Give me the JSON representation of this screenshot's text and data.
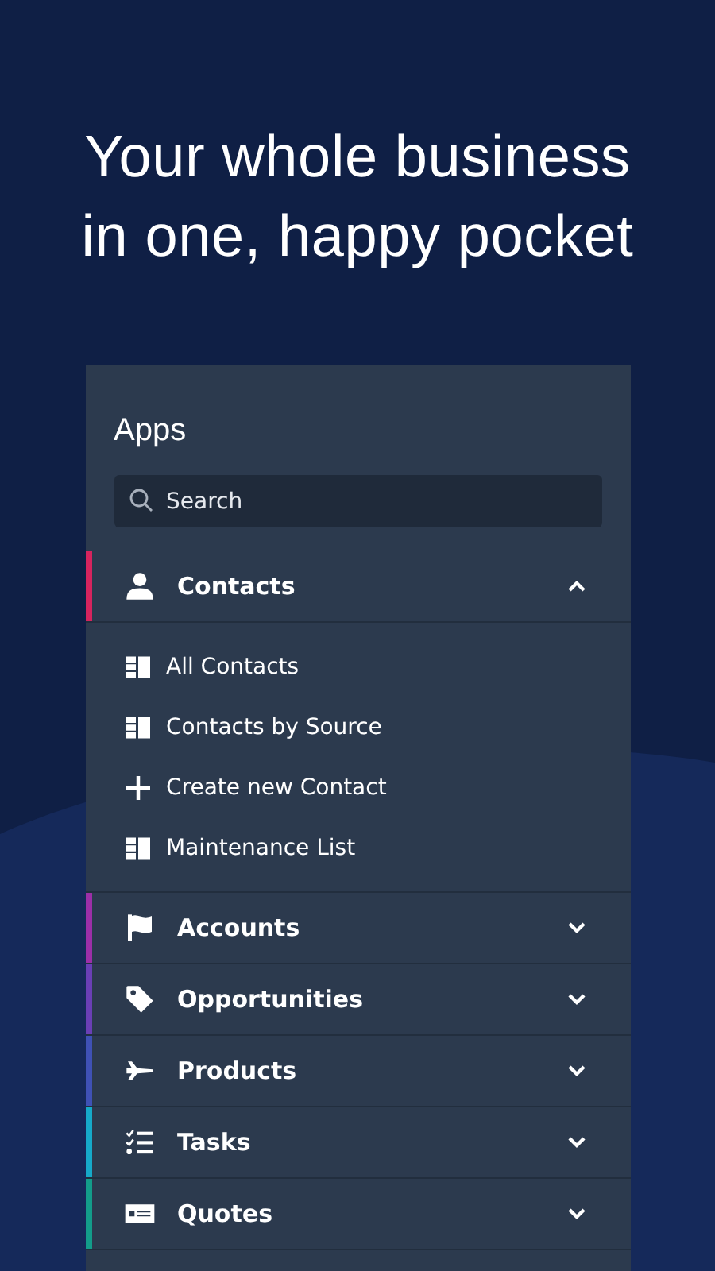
{
  "headline": "Your whole business in one, happy pocket",
  "panel": {
    "title": "Apps",
    "search": {
      "placeholder": "Search"
    },
    "groups": [
      {
        "label": "Contacts",
        "kind": "person",
        "color": "#d6245e",
        "expanded": true,
        "children": [
          {
            "label": "All Contacts",
            "kind": "list"
          },
          {
            "label": "Contacts by Source",
            "kind": "list"
          },
          {
            "label": "Create new Contact",
            "kind": "add"
          },
          {
            "label": "Maintenance List",
            "kind": "list"
          }
        ]
      },
      {
        "label": "Accounts",
        "kind": "flag",
        "color": "#9c2fa8",
        "expanded": false
      },
      {
        "label": "Opportunities",
        "kind": "tag",
        "color": "#6a3fb5",
        "expanded": false
      },
      {
        "label": "Products",
        "kind": "plane",
        "color": "#3f51b5",
        "expanded": false
      },
      {
        "label": "Tasks",
        "kind": "checklist",
        "color": "#16a9c9",
        "expanded": false
      },
      {
        "label": "Quotes",
        "kind": "invoice",
        "color": "#139c8a",
        "expanded": false
      }
    ]
  }
}
